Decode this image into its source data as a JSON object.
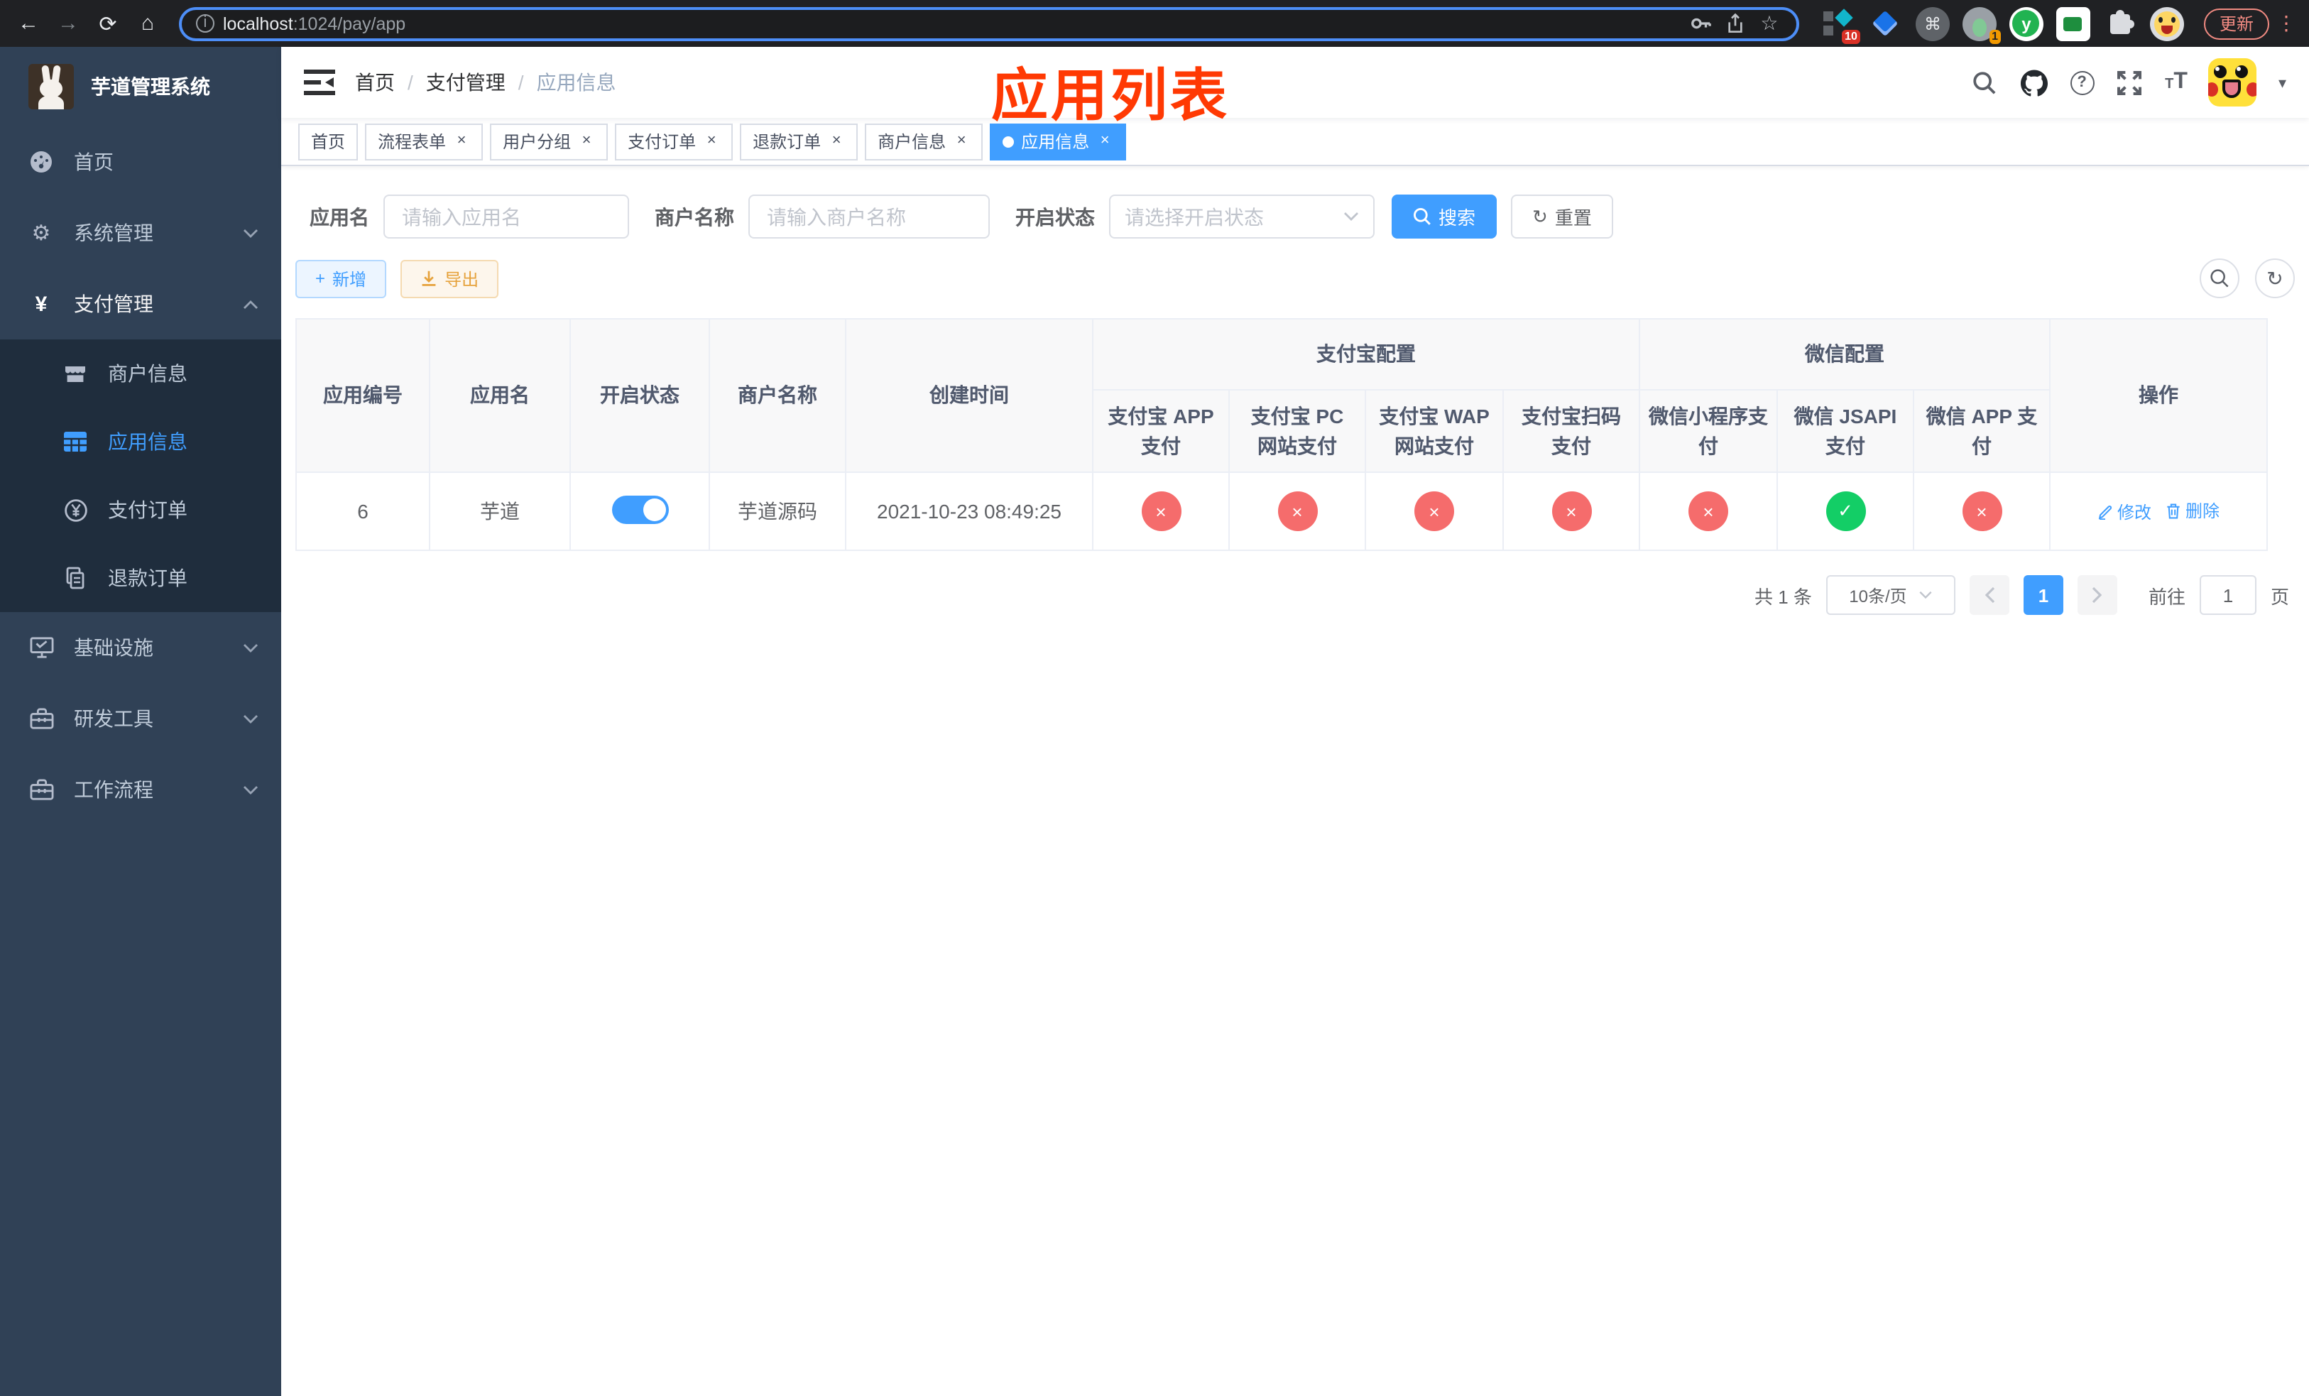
{
  "browser": {
    "url": {
      "host": "localhost",
      "rest": ":1024/pay/app"
    },
    "update_label": "更新",
    "badge_ten": "10",
    "badge_one": "1"
  },
  "icons": {
    "back": "←",
    "forward": "→",
    "reload": "⟳",
    "home": "⌂",
    "info": "i",
    "star": "☆",
    "kebab": "⋮",
    "cmd": "⌘",
    "help": "?",
    "caret": "▾",
    "tt_small": "T",
    "tt_big": "T",
    "yen": "¥",
    "gear": "⚙",
    "close": "×",
    "check": "✓",
    "cross": "×",
    "plus": "+",
    "refresh": "↻",
    "breadcrumb_sep": "/",
    "prev": "‹",
    "next": "›",
    "ext_y": "y"
  },
  "sidebar": {
    "title": "芋道管理系统",
    "menu": [
      {
        "label": "首页"
      },
      {
        "label": "系统管理"
      },
      {
        "label": "支付管理"
      },
      {
        "label": "基础设施"
      },
      {
        "label": "研发工具"
      },
      {
        "label": "工作流程"
      }
    ],
    "submenu": [
      {
        "label": "商户信息"
      },
      {
        "label": "应用信息"
      },
      {
        "label": "支付订单"
      },
      {
        "label": "退款订单"
      }
    ]
  },
  "navbar": {
    "breadcrumb": [
      "首页",
      "支付管理",
      "应用信息"
    ],
    "annotation": "应用列表"
  },
  "tabs": [
    {
      "label": "首页"
    },
    {
      "label": "流程表单"
    },
    {
      "label": "用户分组"
    },
    {
      "label": "支付订单"
    },
    {
      "label": "退款订单"
    },
    {
      "label": "商户信息"
    },
    {
      "label": "应用信息"
    }
  ],
  "filters": {
    "app_name": {
      "label": "应用名",
      "placeholder": "请输入应用名"
    },
    "merchant_name": {
      "label": "商户名称",
      "placeholder": "请输入商户名称"
    },
    "status": {
      "label": "开启状态",
      "placeholder": "请选择开启状态"
    },
    "search_label": "搜索",
    "reset_label": "重置"
  },
  "toolbar": {
    "add_label": "新增",
    "export_label": "导出"
  },
  "table": {
    "simple_headers": [
      "应用编号",
      "应用名",
      "开启状态",
      "商户名称",
      "创建时间"
    ],
    "groups": [
      {
        "label": "支付宝配置",
        "children": [
          "支付宝 APP 支付",
          "支付宝 PC 网站支付",
          "支付宝 WAP 网站支付",
          "支付宝扫码支付"
        ]
      },
      {
        "label": "微信配置",
        "children": [
          "微信小程序支付",
          "微信 JSAPI 支付",
          "微信 APP 支付"
        ]
      }
    ],
    "ops_header": "操作",
    "row": {
      "id": "6",
      "name": "芋道",
      "enabled": true,
      "merchant": "芋道源码",
      "created": "2021-10-23 08:49:25",
      "channel_status": [
        false,
        false,
        false,
        false,
        false,
        true,
        false
      ],
      "edit_label": "修改",
      "delete_label": "删除"
    }
  },
  "pagination": {
    "total": "共 1 条",
    "page_size": "10条/页",
    "page": "1",
    "goto_label": "前往",
    "goto_value": "1",
    "page_suffix": "页"
  }
}
